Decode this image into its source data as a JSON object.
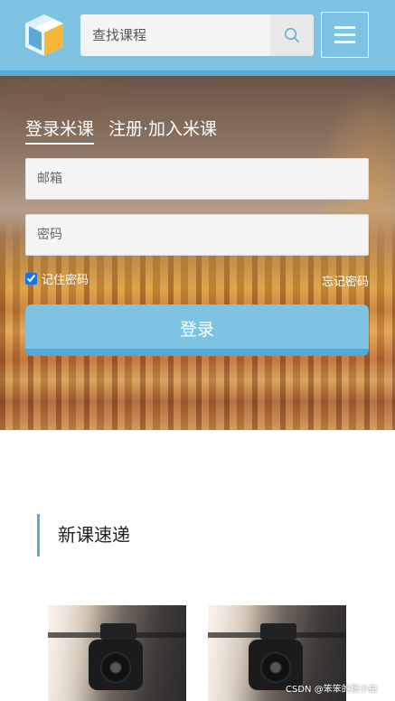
{
  "header": {
    "logo": "cube-logo",
    "search": {
      "placeholder": "查找课程",
      "icon": "search-icon"
    },
    "menu_icon": "hamburger-menu-icon",
    "colors": {
      "bar": "#7fc3e3",
      "bar_border": "#56aed6"
    }
  },
  "login": {
    "tabs": [
      {
        "label": "登录米课",
        "active": true
      },
      {
        "label": "注册·加入米课",
        "active": false
      }
    ],
    "email_placeholder": "邮箱",
    "password_placeholder": "密码",
    "remember_label": "记住密码",
    "remember_checked": true,
    "forgot_label": "忘记密码",
    "submit_label": "登录",
    "colors": {
      "button": "#7fc3e3",
      "button_shadow": "#52a9d3"
    }
  },
  "new_courses": {
    "title": "新课速递",
    "items": [
      {
        "image": "camera-photo"
      },
      {
        "image": "camera-photo"
      }
    ]
  },
  "watermark": "CSDN @笨笨的张小白"
}
